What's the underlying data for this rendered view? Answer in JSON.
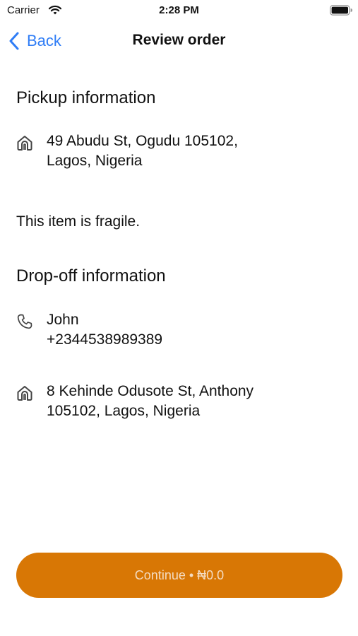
{
  "status_bar": {
    "carrier": "Carrier",
    "time": "2:28 PM"
  },
  "nav": {
    "back_label": "Back",
    "title": "Review order"
  },
  "pickup": {
    "section_title": "Pickup information",
    "address_line1": "49 Abudu St, Ogudu 105102,",
    "address_line2": "Lagos, Nigeria",
    "address_icon": "home-icon",
    "note": "This item is fragile."
  },
  "dropoff": {
    "section_title": "Drop-off information",
    "contact_name": "John",
    "contact_phone": "+2344538989389",
    "contact_icon": "phone-icon",
    "address_line1": "8 Kehinde Odusote St, Anthony",
    "address_line2": "105102, Lagos, Nigeria",
    "address_icon": "home-icon"
  },
  "continue_button": {
    "label": "Continue • ₦0.0"
  },
  "colors": {
    "accent_blue": "#2f7df6",
    "button_orange": "#d87705",
    "button_text": "#f4dcc2"
  }
}
